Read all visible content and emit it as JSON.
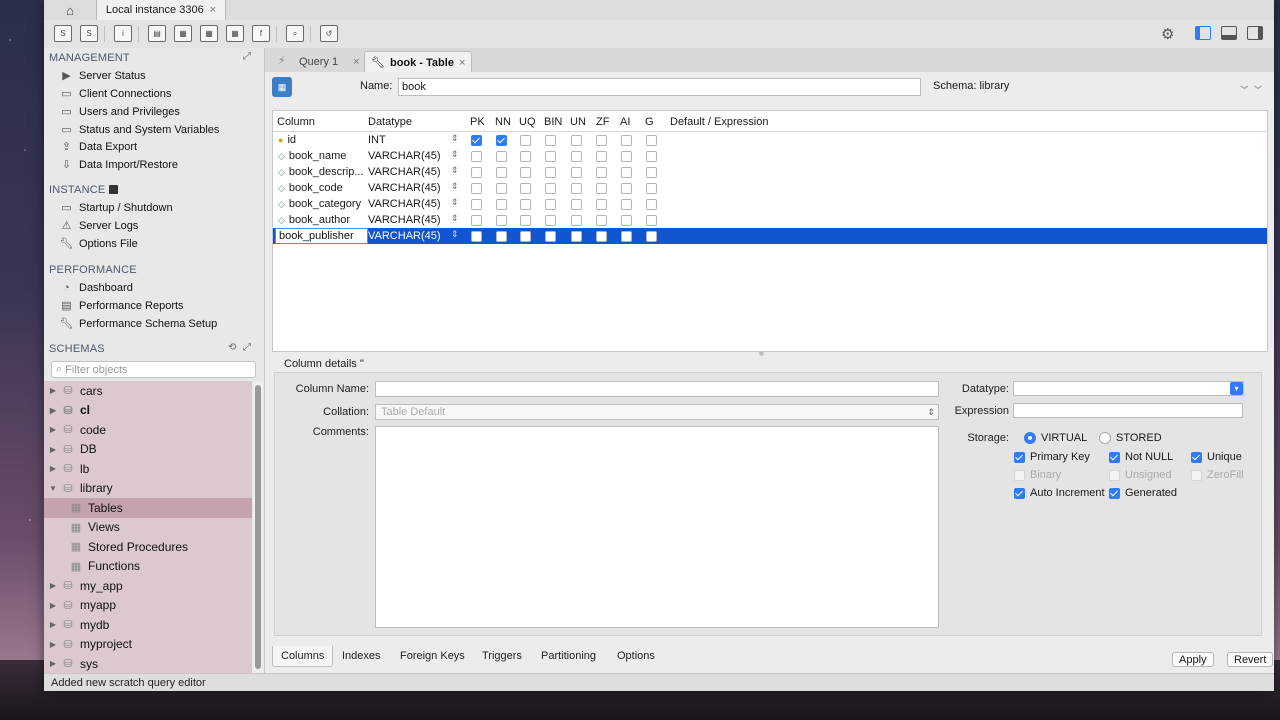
{
  "connection_tab": {
    "label": "Local instance 3306",
    "close": "×"
  },
  "sidebar": {
    "management": {
      "title": "MANAGEMENT",
      "items": [
        {
          "label": "Server Status",
          "icon": "play-icon"
        },
        {
          "label": "Client Connections",
          "icon": "monitor-icon"
        },
        {
          "label": "Users and Privileges",
          "icon": "users-icon"
        },
        {
          "label": "Status and System Variables",
          "icon": "monitor-icon"
        },
        {
          "label": "Data Export",
          "icon": "upload-icon"
        },
        {
          "label": "Data Import/Restore",
          "icon": "download-icon"
        }
      ]
    },
    "instance": {
      "title": "INSTANCE",
      "items": [
        {
          "label": "Startup / Shutdown",
          "icon": "monitor-icon"
        },
        {
          "label": "Server Logs",
          "icon": "warning-icon"
        },
        {
          "label": "Options File",
          "icon": "wrench-icon"
        }
      ]
    },
    "performance": {
      "title": "PERFORMANCE",
      "items": [
        {
          "label": "Dashboard",
          "icon": "gauge-icon"
        },
        {
          "label": "Performance Reports",
          "icon": "report-icon"
        },
        {
          "label": "Performance Schema Setup",
          "icon": "wrench-icon"
        }
      ]
    },
    "schemas": {
      "title": "SCHEMAS",
      "filter_placeholder": "Filter objects",
      "items": [
        {
          "label": "cars"
        },
        {
          "label": "cl"
        },
        {
          "label": "code"
        },
        {
          "label": "DB"
        },
        {
          "label": "lb"
        },
        {
          "label": "library"
        },
        {
          "label": "Tables"
        },
        {
          "label": "Views"
        },
        {
          "label": "Stored Procedures"
        },
        {
          "label": "Functions"
        },
        {
          "label": "my_app"
        },
        {
          "label": "myapp"
        },
        {
          "label": "mydb"
        },
        {
          "label": "myproject"
        },
        {
          "label": "sys"
        }
      ]
    }
  },
  "editor_tabs": [
    {
      "label": "Query 1",
      "close": "×"
    },
    {
      "label": "book - Table",
      "close": "×"
    }
  ],
  "table_editor": {
    "name_label": "Name:",
    "name_value": "book",
    "schema_label": "Schema:  library",
    "headers": [
      "Column",
      "Datatype",
      "PK",
      "NN",
      "UQ",
      "BIN",
      "UN",
      "ZF",
      "AI",
      "G",
      "Default / Expression"
    ],
    "rows": [
      {
        "name": "id",
        "type": "INT",
        "flags": [
          true,
          true,
          false,
          false,
          false,
          false,
          false,
          false
        ]
      },
      {
        "name": "book_name",
        "type": "VARCHAR(45)",
        "flags": [
          false,
          false,
          false,
          false,
          false,
          false,
          false,
          false
        ]
      },
      {
        "name": "book_descrip...",
        "type": "VARCHAR(45)",
        "flags": [
          false,
          false,
          false,
          false,
          false,
          false,
          false,
          false
        ]
      },
      {
        "name": "book_code",
        "type": "VARCHAR(45)",
        "flags": [
          false,
          false,
          false,
          false,
          false,
          false,
          false,
          false
        ]
      },
      {
        "name": "book_category",
        "type": "VARCHAR(45)",
        "flags": [
          false,
          false,
          false,
          false,
          false,
          false,
          false,
          false
        ]
      },
      {
        "name": "book_author",
        "type": "VARCHAR(45)",
        "flags": [
          false,
          false,
          false,
          false,
          false,
          false,
          false,
          false
        ]
      },
      {
        "name": "book_publisher",
        "type": "VARCHAR(45)",
        "flags": [
          false,
          false,
          false,
          false,
          false,
          false,
          false,
          false
        ]
      }
    ]
  },
  "column_details": {
    "title": "Column details ''",
    "column_name_label": "Column Name:",
    "collation_label": "Collation:",
    "collation_value": "Table Default",
    "comments_label": "Comments:",
    "datatype_label": "Datatype:",
    "expression_label": "Expression",
    "storage_label": "Storage:",
    "virtual": "VIRTUAL",
    "stored": "STORED",
    "primary_key": "Primary Key",
    "not_null": "Not NULL",
    "unique": "Unique",
    "binary": "Binary",
    "unsigned": "Unsigned",
    "zerofill": "ZeroFill",
    "auto_increment": "Auto Increment",
    "generated": "Generated"
  },
  "bottom_tabs": [
    "Columns",
    "Indexes",
    "Foreign Keys",
    "Triggers",
    "Partitioning",
    "Options"
  ],
  "buttons": {
    "apply": "Apply",
    "revert": "Revert"
  },
  "status": "Added new scratch query editor"
}
